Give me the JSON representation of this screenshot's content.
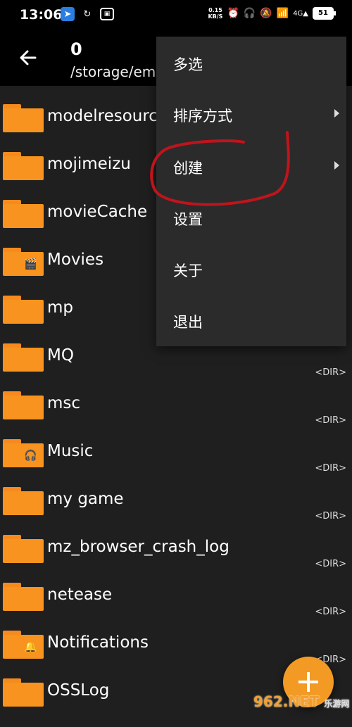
{
  "status_bar": {
    "time": "13:06",
    "net_speed_value": "0.15",
    "net_speed_unit": "KB/S",
    "battery": "51"
  },
  "header": {
    "title": "0",
    "path": "/storage/em"
  },
  "files": [
    {
      "name": "modelresource",
      "type": "folder",
      "dir": ""
    },
    {
      "name": "mojimeizu",
      "type": "folder",
      "dir": ""
    },
    {
      "name": "movieCache",
      "type": "folder",
      "dir": ""
    },
    {
      "name": "Movies",
      "type": "movies",
      "dir": ""
    },
    {
      "name": "mp",
      "type": "folder",
      "dir": ""
    },
    {
      "name": "MQ",
      "type": "folder",
      "dir": "<DIR>"
    },
    {
      "name": "msc",
      "type": "folder",
      "dir": "<DIR>"
    },
    {
      "name": "Music",
      "type": "music",
      "dir": "<DIR>"
    },
    {
      "name": "my game",
      "type": "folder",
      "dir": "<DIR>"
    },
    {
      "name": "mz_browser_crash_log",
      "type": "folder",
      "dir": "<DIR>"
    },
    {
      "name": "netease",
      "type": "folder",
      "dir": "<DIR>"
    },
    {
      "name": "Notifications",
      "type": "notifications",
      "dir": "<DIR>"
    },
    {
      "name": "OSSLog",
      "type": "folder",
      "dir": ""
    }
  ],
  "menu": {
    "items": [
      {
        "label": "多选",
        "submenu": false
      },
      {
        "label": "排序方式",
        "submenu": true
      },
      {
        "label": "创建",
        "submenu": true
      },
      {
        "label": "设置",
        "submenu": false
      },
      {
        "label": "关于",
        "submenu": false
      },
      {
        "label": "退出",
        "submenu": false
      }
    ]
  },
  "watermark": {
    "brand": "962.NET",
    "sub": "乐游网"
  },
  "colors": {
    "accent": "#f7931e",
    "annotation": "#c0141c"
  }
}
